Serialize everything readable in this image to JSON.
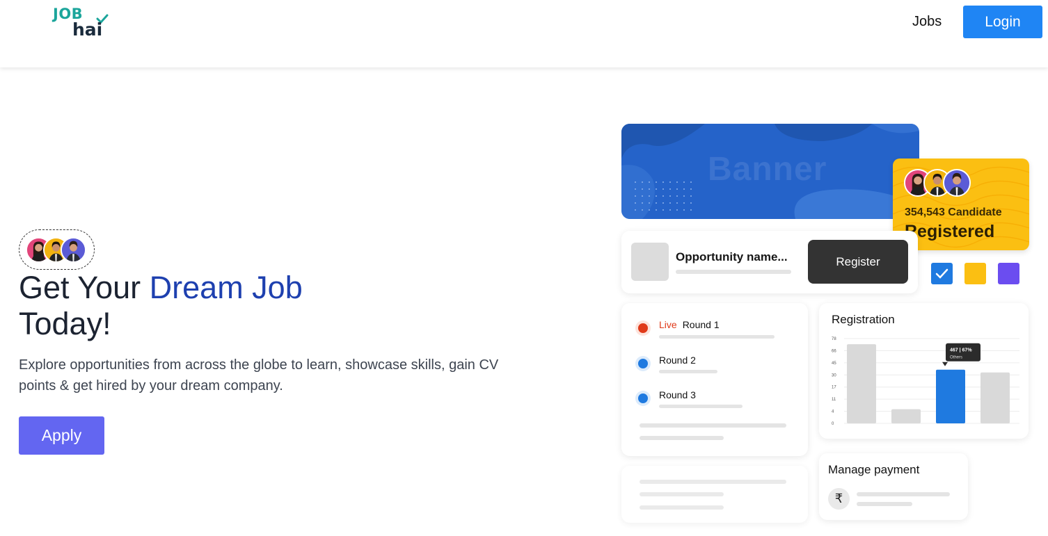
{
  "header": {
    "logo_top": "JOB",
    "logo_bottom": "hai",
    "nav_jobs": "Jobs",
    "login_label": "Login"
  },
  "hero": {
    "title_part1": "Get Your ",
    "title_accent": "Dream Job",
    "title_part2": "Today!",
    "description": "Explore opportunities from across the globe to learn, showcase skills, gain CV points & get hired by your dream company.",
    "apply_label": "Apply"
  },
  "illustration": {
    "banner_text": "Banner",
    "candidate_count": "354,543 Candidate",
    "registered_label": "Registered",
    "opportunity_name": "Opportunity name...",
    "register_label": "Register",
    "rounds": [
      {
        "status": "Live",
        "label": "Round 1"
      },
      {
        "status": "",
        "label": "Round 2"
      },
      {
        "status": "",
        "label": "Round 3"
      }
    ],
    "chart_title": "Registration",
    "payment_title": "Manage payment",
    "rupee_symbol": "₹"
  },
  "chart_data": {
    "type": "bar",
    "title": "Registration",
    "y_ticks": [
      "78",
      "66",
      "45",
      "30",
      "17",
      "11",
      "4",
      "0"
    ],
    "values": [
      56,
      10,
      38,
      36
    ],
    "highlight_index": 2,
    "tooltip": {
      "value": "467",
      "percent": "67%",
      "label": "Others"
    }
  },
  "colors": {
    "brand_teal": "#1ba59b",
    "primary_blue": "#1f85f4",
    "accent_indigo": "#6366f1",
    "title_accent": "#1e40af",
    "banner_blue": "#2563c9",
    "candidate_yellow": "#fbbf12",
    "square_blue": "#1f7ae0",
    "square_yellow": "#fbbf12",
    "square_purple": "#6b4df0"
  }
}
